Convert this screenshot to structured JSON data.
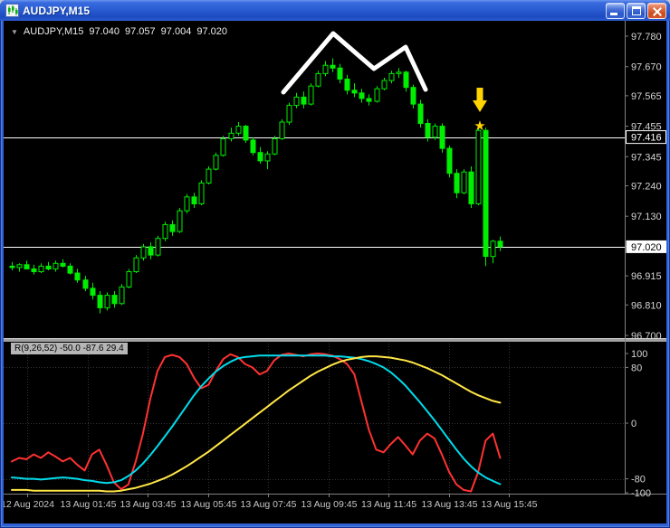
{
  "window": {
    "title": "AUDJPY,M15"
  },
  "header": {
    "dropdown_icon": "▼",
    "symbol": "AUDJPY,M15",
    "open": "97.040",
    "high": "97.057",
    "low": "97.004",
    "close": "97.020"
  },
  "indicator_label": "R(9,26,52) -50.0 -87.6 29.4",
  "colors": {
    "background": "#000000",
    "bull_fill": "#000000",
    "bear_fill": "#00ef00",
    "candle_outline": "#00ef00",
    "hline": "#ffffff",
    "grid": "#343434",
    "axis_text": "#d4d4d4",
    "frame": "#808080",
    "splitter": "#a0a0a0",
    "current_price_bg": "#ffffff"
  },
  "chart_data": {
    "type": "candlestick",
    "symbol": "AUDJPY",
    "timeframe": "M15",
    "price_range": [
      96.7,
      97.78
    ],
    "price_axis_labels": [
      "97.780",
      "97.670",
      "97.565",
      "97.455",
      "97.345",
      "97.240",
      "97.130",
      "97.020",
      "96.915",
      "96.810",
      "96.700"
    ],
    "hline_levels": [
      97.416,
      97.02
    ],
    "hline_axis_labels": [
      "97.416"
    ],
    "current_price": "97.020",
    "time_axis_labels": [
      "12 Aug 2024",
      "13 Aug 01:45",
      "13 Aug 03:45",
      "13 Aug 05:45",
      "13 Aug 07:45",
      "13 Aug 09:45",
      "13 Aug 11:45",
      "13 Aug 13:45",
      "13 Aug 15:45"
    ],
    "candles": [
      [
        96.95,
        96.965,
        96.935,
        96.945
      ],
      [
        96.945,
        96.96,
        96.93,
        96.955
      ],
      [
        96.955,
        96.97,
        96.94,
        96.94
      ],
      [
        96.94,
        96.955,
        96.92,
        96.93
      ],
      [
        96.93,
        96.96,
        96.925,
        96.95
      ],
      [
        96.95,
        96.965,
        96.935,
        96.94
      ],
      [
        96.94,
        96.97,
        96.93,
        96.96
      ],
      [
        96.96,
        96.975,
        96.945,
        96.95
      ],
      [
        96.95,
        96.96,
        96.92,
        96.925
      ],
      [
        96.925,
        96.94,
        96.89,
        96.9
      ],
      [
        96.9,
        96.915,
        96.86,
        96.87
      ],
      [
        96.87,
        96.89,
        96.83,
        96.845
      ],
      [
        96.845,
        96.86,
        96.78,
        96.8
      ],
      [
        96.8,
        96.855,
        96.79,
        96.845
      ],
      [
        96.845,
        96.86,
        96.8,
        96.815
      ],
      [
        96.815,
        96.885,
        96.81,
        96.875
      ],
      [
        96.875,
        96.94,
        96.87,
        96.93
      ],
      [
        96.93,
        96.99,
        96.925,
        96.98
      ],
      [
        96.98,
        97.03,
        96.97,
        97.02
      ],
      [
        97.02,
        97.035,
        96.975,
        96.99
      ],
      [
        96.99,
        97.06,
        96.985,
        97.05
      ],
      [
        97.05,
        97.11,
        97.04,
        97.1
      ],
      [
        97.1,
        97.115,
        97.06,
        97.075
      ],
      [
        97.075,
        97.16,
        97.07,
        97.15
      ],
      [
        97.15,
        97.21,
        97.14,
        97.2
      ],
      [
        97.2,
        97.215,
        97.16,
        97.175
      ],
      [
        97.175,
        97.26,
        97.17,
        97.25
      ],
      [
        97.25,
        97.31,
        97.245,
        97.3
      ],
      [
        97.3,
        97.36,
        97.295,
        97.35
      ],
      [
        97.35,
        97.42,
        97.345,
        97.41
      ],
      [
        97.41,
        97.45,
        97.4,
        97.43
      ],
      [
        97.43,
        97.47,
        97.42,
        97.455
      ],
      [
        97.455,
        97.46,
        97.395,
        97.405
      ],
      [
        97.405,
        97.415,
        97.35,
        97.36
      ],
      [
        97.36,
        97.38,
        97.32,
        97.33
      ],
      [
        97.33,
        97.365,
        97.3,
        97.355
      ],
      [
        97.355,
        97.42,
        97.35,
        97.41
      ],
      [
        97.41,
        97.48,
        97.405,
        97.47
      ],
      [
        97.47,
        97.54,
        97.46,
        97.53
      ],
      [
        97.53,
        97.575,
        97.52,
        97.56
      ],
      [
        97.56,
        97.58,
        97.52,
        97.535
      ],
      [
        97.535,
        97.61,
        97.53,
        97.6
      ],
      [
        97.6,
        97.655,
        97.595,
        97.645
      ],
      [
        97.645,
        97.69,
        97.635,
        97.675
      ],
      [
        97.675,
        97.7,
        97.65,
        97.665
      ],
      [
        97.665,
        97.68,
        97.61,
        97.625
      ],
      [
        97.625,
        97.64,
        97.57,
        97.585
      ],
      [
        97.585,
        97.61,
        97.56,
        97.575
      ],
      [
        97.575,
        97.59,
        97.54,
        97.555
      ],
      [
        97.555,
        97.57,
        97.53,
        97.545
      ],
      [
        97.545,
        97.6,
        97.54,
        97.59
      ],
      [
        97.59,
        97.63,
        97.585,
        97.62
      ],
      [
        97.62,
        97.655,
        97.61,
        97.645
      ],
      [
        97.645,
        97.665,
        97.63,
        97.65
      ],
      [
        97.65,
        97.655,
        97.58,
        97.595
      ],
      [
        97.595,
        97.605,
        97.52,
        97.535
      ],
      [
        97.535,
        97.55,
        97.45,
        97.465
      ],
      [
        97.465,
        97.48,
        97.4,
        97.415
      ],
      [
        97.415,
        97.465,
        97.405,
        97.455
      ],
      [
        97.455,
        97.465,
        97.36,
        97.375
      ],
      [
        97.375,
        97.385,
        97.27,
        97.285
      ],
      [
        97.285,
        97.3,
        97.195,
        97.215
      ],
      [
        97.215,
        97.3,
        97.21,
        97.29
      ],
      [
        97.29,
        97.31,
        97.16,
        97.175
      ],
      [
        97.175,
        97.455,
        97.17,
        97.44
      ],
      [
        97.44,
        97.45,
        96.95,
        96.985
      ],
      [
        96.985,
        97.045,
        96.96,
        97.04
      ],
      [
        97.04,
        97.057,
        97.004,
        97.02
      ]
    ],
    "oscillator": {
      "name": "R(9,26,52)",
      "current_values": [
        -50.0,
        -87.6,
        29.4
      ],
      "range": [
        -100,
        100
      ],
      "axis_labels": [
        "100",
        "80",
        "0",
        "-80",
        "-100"
      ],
      "grid_values": [
        80,
        0,
        -80
      ],
      "series": [
        {
          "name": "r-fast-line",
          "color": "#ff3232",
          "values": [
            -55,
            -50,
            -52,
            -45,
            -50,
            -42,
            -48,
            -55,
            -50,
            -60,
            -68,
            -45,
            -38,
            -60,
            -85,
            -95,
            -88,
            -55,
            -15,
            35,
            75,
            95,
            98,
            95,
            85,
            65,
            50,
            55,
            75,
            92,
            99,
            95,
            85,
            80,
            70,
            75,
            90,
            98,
            100,
            98,
            96,
            99,
            100,
            99,
            97,
            92,
            85,
            70,
            30,
            -10,
            -38,
            -42,
            -30,
            -20,
            -32,
            -45,
            -25,
            -15,
            -22,
            -45,
            -70,
            -88,
            -96,
            -98,
            -70,
            -25,
            -15,
            -50
          ]
        },
        {
          "name": "r-mid-line",
          "color": "#00dcec",
          "values": [
            -78,
            -79,
            -80,
            -80,
            -81,
            -80,
            -79,
            -78,
            -79,
            -80,
            -82,
            -83,
            -85,
            -86,
            -85,
            -82,
            -76,
            -68,
            -58,
            -46,
            -33,
            -19,
            -5,
            10,
            25,
            40,
            53,
            64,
            74,
            82,
            88,
            93,
            95,
            96,
            97,
            97,
            97,
            97,
            97,
            97,
            97,
            97,
            97,
            97,
            96,
            96,
            95,
            94,
            92,
            89,
            85,
            80,
            73,
            64,
            54,
            42,
            30,
            17,
            4,
            -10,
            -24,
            -38,
            -51,
            -62,
            -71,
            -78,
            -83,
            -87.6
          ]
        },
        {
          "name": "r-slow-line",
          "color": "#ffe646",
          "values": [
            -96,
            -96,
            -96,
            -97,
            -97,
            -97,
            -97,
            -97,
            -97,
            -97,
            -97,
            -97,
            -97,
            -98,
            -98,
            -97,
            -95,
            -93,
            -90,
            -87,
            -83,
            -79,
            -74,
            -68,
            -62,
            -55,
            -48,
            -41,
            -33,
            -25,
            -17,
            -9,
            -1,
            7,
            15,
            23,
            31,
            39,
            47,
            54,
            61,
            68,
            74,
            79,
            84,
            88,
            91,
            93,
            95,
            96,
            96,
            95,
            94,
            92,
            90,
            87,
            83,
            79,
            74,
            69,
            63,
            57,
            51,
            45,
            40,
            36,
            32,
            29.4
          ]
        }
      ]
    },
    "annotations": {
      "zigzag": {
        "color": "#ffffff",
        "width": 5,
        "points": [
          [
            309,
            79
          ],
          [
            364,
            14
          ],
          [
            409,
            53
          ],
          [
            444,
            29
          ],
          [
            466,
            76
          ]
        ]
      },
      "down_arrow": {
        "color": "#ffd400",
        "x": 526,
        "y": 74
      },
      "star": {
        "glyph": "★",
        "color": "#ffd400",
        "x": 526,
        "y": 121
      }
    }
  }
}
